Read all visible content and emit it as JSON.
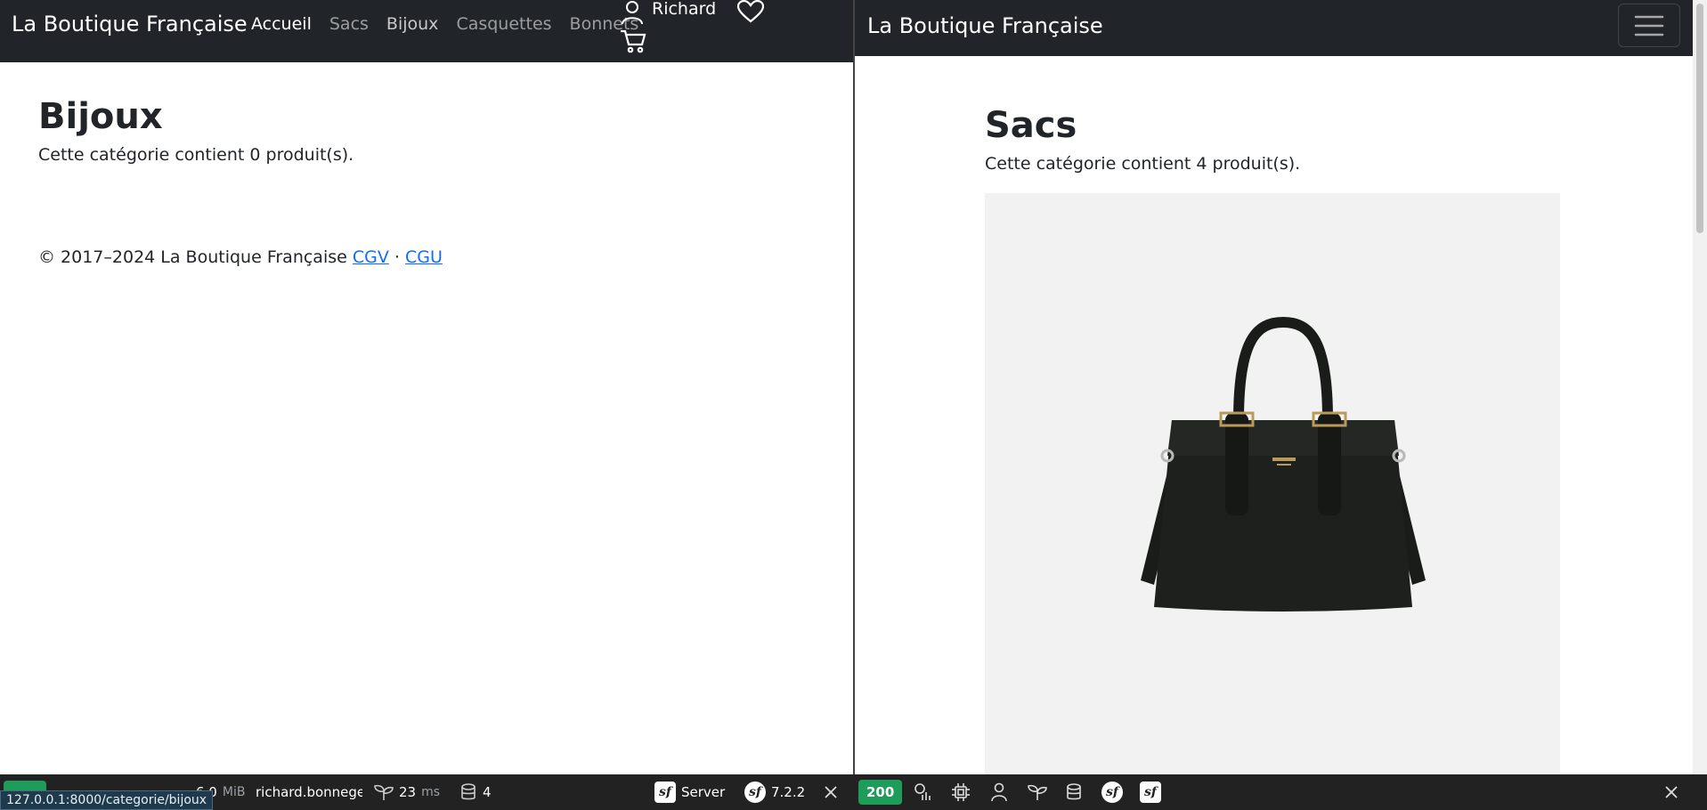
{
  "left": {
    "brand": "La Boutique Française",
    "nav": [
      {
        "label": "Accueil",
        "active": true
      },
      {
        "label": "Sacs",
        "active": false
      },
      {
        "label": "Bijoux",
        "active": false
      },
      {
        "label": "Casquettes",
        "active": false
      },
      {
        "label": "Bonnets",
        "active": false
      }
    ],
    "user_name": "Richard",
    "page_title": "Bijoux",
    "count_text": "Cette catégorie contient 0 produit(s).",
    "footer": {
      "copyright": "© 2017–2024 La Boutique Française",
      "cgv": "CGV",
      "separator": "·",
      "cgu": "CGU"
    }
  },
  "right": {
    "brand": "La Boutique Française",
    "page_title": "Sacs",
    "count_text": "Cette catégorie contient 4 produit(s)."
  },
  "toolbar": {
    "memory_value": "6.0",
    "memory_unit": "MiB",
    "user": "richard.bonneger",
    "time_value": "23",
    "time_unit": "ms",
    "db_queries": "4",
    "server_label": "Server",
    "symfony_version": "7.2.2",
    "status_code": "200"
  },
  "status_url": "127.0.0.1:8000/categorie/bijoux",
  "colors": {
    "navbar": "#212529",
    "link": "#0d6efd",
    "toolbar": "#222222",
    "status_green": "#1e9c5a"
  }
}
